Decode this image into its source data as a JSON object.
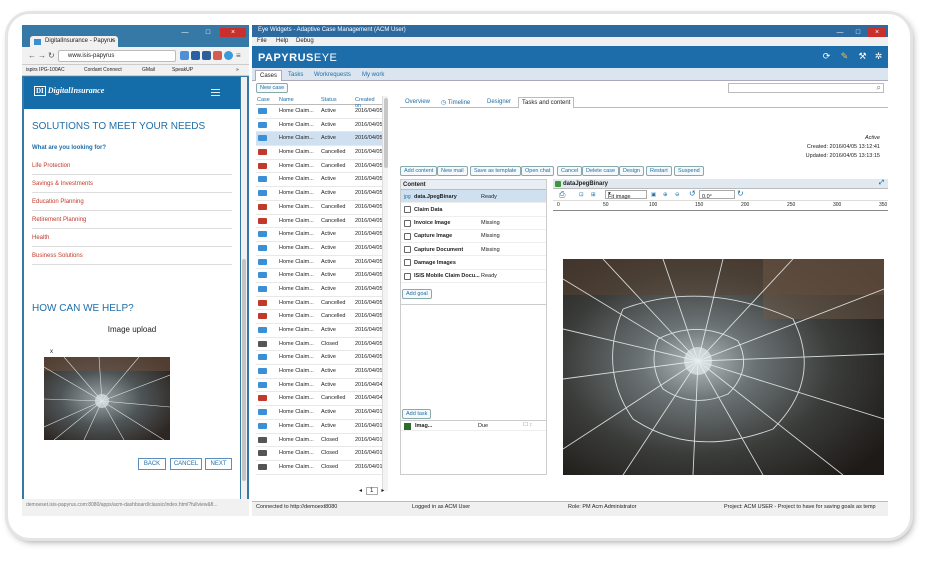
{
  "browser": {
    "tab_title": "DigitalInsurance - Papyrus",
    "tab_close": "×",
    "url": "www.isis-papyrus",
    "bookmarks": [
      "ispirs IPG-100AC",
      "Cordant Connect",
      "GMail",
      "SpeakUP"
    ],
    "status_url": "demoeset.isis-papyrus.com:8080/apps/acm-dashboard/classic/index.html?fullview&fl...",
    "back_glyph": "←",
    "forward_glyph": "→",
    "reload_glyph": "↻",
    "menu_glyph": "≡",
    "overflow_glyph": "»",
    "win_min": "—",
    "win_max": "□",
    "win_close": "×"
  },
  "site": {
    "logo_box": "DI",
    "logo_text": "DigitalInsurance",
    "title": "SOLUTIONS TO MEET YOUR NEEDS",
    "question": "What are you looking for?",
    "links": [
      "Life Protection",
      "Savings & Investments",
      "Education Planning",
      "Retirement Planning",
      "Health",
      "Business Solutions"
    ],
    "help_title": "HOW CAN WE HELP?",
    "upload_title": "Image upload",
    "remove_glyph": "x",
    "buttons": {
      "back": "BACK",
      "cancel": "CANCEL",
      "next": "NEXT"
    }
  },
  "app": {
    "window_title": "Eye Widgets - Adaptive Case Management (ACM User)",
    "menu": [
      "File",
      "Help",
      "Debug"
    ],
    "logo_main": "PAPYRUS",
    "logo_sub": "EYE",
    "banner_icons": [
      "refresh-icon",
      "notes-icon",
      "tools-icon",
      "settings-icon"
    ],
    "banner_glyphs": [
      "⟳",
      "✎",
      "⚒",
      "✲"
    ],
    "win_ctl": [
      "—",
      "□",
      "×"
    ],
    "tabs": [
      "Cases",
      "Tasks",
      "Workrequests",
      "My work"
    ],
    "search_glyph": "⌕",
    "new_case": "New case",
    "columns": [
      "Case",
      "Name",
      "Status",
      "Created on"
    ],
    "cases": [
      {
        "name": "Home Claim...",
        "status": "Active",
        "date": "2016/04/05",
        "color": "#3a8fd6"
      },
      {
        "name": "Home Claim...",
        "status": "Active",
        "date": "2016/04/05",
        "color": "#3a8fd6"
      },
      {
        "name": "Home Claim...",
        "status": "Active",
        "date": "2016/04/05",
        "color": "#3a8fd6"
      },
      {
        "name": "Home Claim...",
        "status": "Cancelled",
        "date": "2016/04/05",
        "color": "#c0392b"
      },
      {
        "name": "Home Claim...",
        "status": "Cancelled",
        "date": "2016/04/05",
        "color": "#c0392b"
      },
      {
        "name": "Home Claim...",
        "status": "Active",
        "date": "2016/04/05",
        "color": "#3a8fd6"
      },
      {
        "name": "Home Claim...",
        "status": "Active",
        "date": "2016/04/05",
        "color": "#3a8fd6"
      },
      {
        "name": "Home Claim...",
        "status": "Cancelled",
        "date": "2016/04/05",
        "color": "#c0392b"
      },
      {
        "name": "Home Claim...",
        "status": "Cancelled",
        "date": "2016/04/05",
        "color": "#c0392b"
      },
      {
        "name": "Home Claim...",
        "status": "Active",
        "date": "2016/04/05",
        "color": "#3a8fd6"
      },
      {
        "name": "Home Claim...",
        "status": "Active",
        "date": "2016/04/05",
        "color": "#3a8fd6"
      },
      {
        "name": "Home Claim...",
        "status": "Active",
        "date": "2016/04/05",
        "color": "#3a8fd6"
      },
      {
        "name": "Home Claim...",
        "status": "Active",
        "date": "2016/04/05",
        "color": "#3a8fd6"
      },
      {
        "name": "Home Claim...",
        "status": "Active",
        "date": "2016/04/05",
        "color": "#3a8fd6"
      },
      {
        "name": "Home Claim...",
        "status": "Cancelled",
        "date": "2016/04/05",
        "color": "#c0392b"
      },
      {
        "name": "Home Claim...",
        "status": "Cancelled",
        "date": "2016/04/05",
        "color": "#c0392b"
      },
      {
        "name": "Home Claim...",
        "status": "Active",
        "date": "2016/04/05",
        "color": "#3a8fd6"
      },
      {
        "name": "Home Claim...",
        "status": "Closed",
        "date": "2016/04/05",
        "color": "#555555"
      },
      {
        "name": "Home Claim...",
        "status": "Active",
        "date": "2016/04/05",
        "color": "#3a8fd6"
      },
      {
        "name": "Home Claim...",
        "status": "Active",
        "date": "2016/04/05",
        "color": "#3a8fd6"
      },
      {
        "name": "Home Claim...",
        "status": "Active",
        "date": "2016/04/04",
        "color": "#3a8fd6"
      },
      {
        "name": "Home Claim...",
        "status": "Cancelled",
        "date": "2016/04/04",
        "color": "#c0392b"
      },
      {
        "name": "Home Claim...",
        "status": "Active",
        "date": "2016/04/01",
        "color": "#3a8fd6"
      },
      {
        "name": "Home Claim...",
        "status": "Active",
        "date": "2016/04/01",
        "color": "#3a8fd6"
      },
      {
        "name": "Home Claim...",
        "status": "Closed",
        "date": "2016/04/01",
        "color": "#555555"
      },
      {
        "name": "Home Claim...",
        "status": "Closed",
        "date": "2016/04/01",
        "color": "#555555"
      },
      {
        "name": "Home Claim...",
        "status": "Closed",
        "date": "2016/04/01",
        "color": "#555555"
      }
    ],
    "pager": {
      "prev": "◂",
      "page": "1",
      "next": "▸"
    },
    "case_tabs": [
      "Overview",
      "Timeline",
      "Designer",
      "Tasks and content"
    ],
    "state": "Active",
    "created": "Created: 2016/04/05 13:12:41",
    "updated": "Updated: 2016/04/05 13:13:15",
    "actions": [
      "Add content",
      "New mail",
      "Save as template",
      "Open chat",
      "Cancel",
      "Delete case",
      "Design",
      "Restart",
      "Suspend"
    ],
    "content_title": "Content",
    "content": [
      {
        "name": "data.JpegBinary",
        "state": "Ready",
        "icon": "jpg"
      },
      {
        "name": "Claim Data",
        "state": "",
        "icon": ""
      },
      {
        "name": "Invoice Image",
        "state": "Missing",
        "icon": ""
      },
      {
        "name": "Capture Image",
        "state": "Missing",
        "icon": ""
      },
      {
        "name": "Capture Document",
        "state": "Missing",
        "icon": ""
      },
      {
        "name": "Damage Images",
        "state": "",
        "icon": ""
      },
      {
        "name": "ISIS Mobile Claim Docu...",
        "state": "Ready",
        "icon": ""
      }
    ],
    "add_goal": "Add goal",
    "add_task": "Add task",
    "task": {
      "name": "Imag...",
      "due": "Due",
      "extra": "☐ ↕"
    },
    "viewer_title": "dataJpegBinary",
    "fit_label": "Fit image",
    "rotation": "0.0°",
    "ruler": [
      "0",
      "50",
      "100",
      "150",
      "200",
      "250",
      "300",
      "350"
    ],
    "status": {
      "connected": "Connected to http://demoext8080",
      "logged": "Logged in as ACM User",
      "role": "Role: PM Acm Administrator",
      "project": "Project: ACM USER - Project to have for saving goals as temp"
    }
  }
}
